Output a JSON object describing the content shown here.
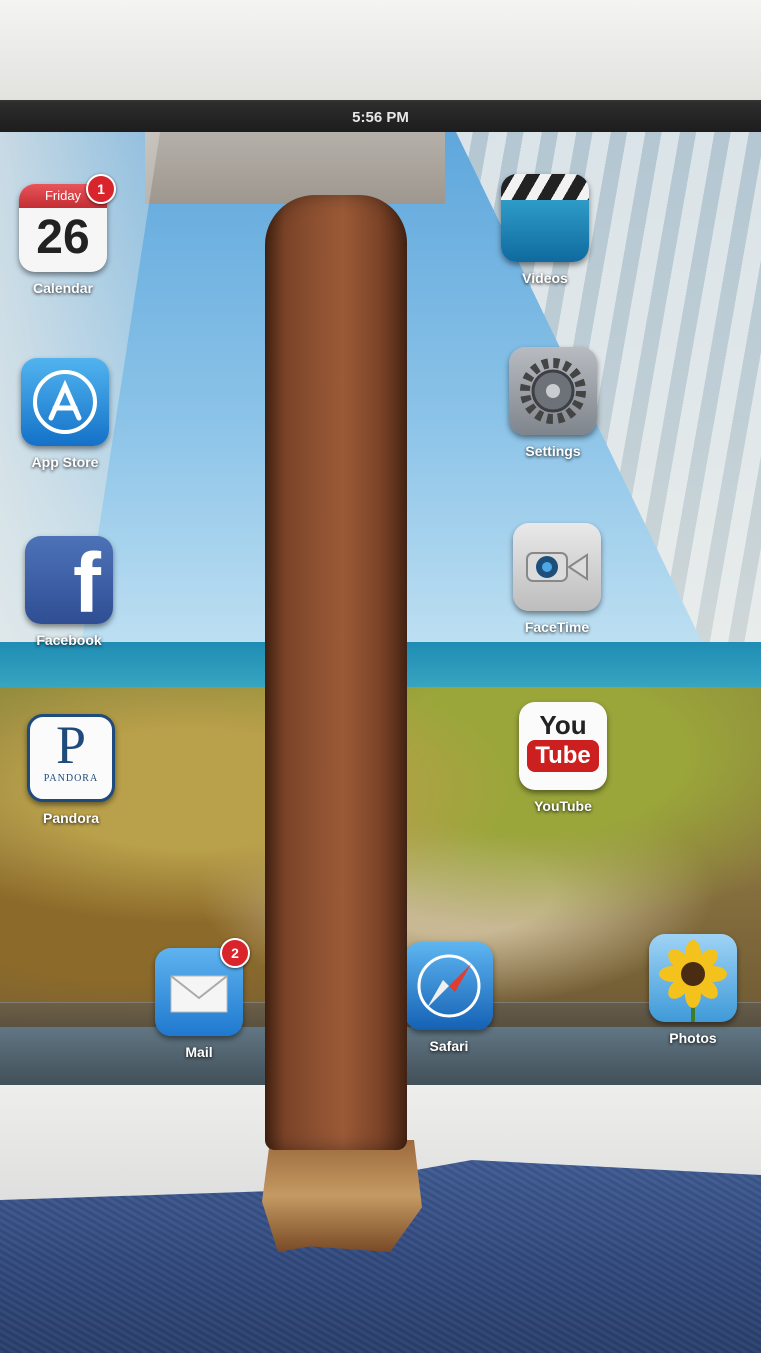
{
  "status_bar": {
    "time": "5:56 PM"
  },
  "home_screen": {
    "left_column": [
      {
        "label": "Calendar",
        "weekday": "Friday",
        "day": "26",
        "badge": "1",
        "icon": "calendar-icon"
      },
      {
        "label": "App Store",
        "icon": "app-store-icon"
      },
      {
        "label": "Facebook",
        "icon": "facebook-icon"
      },
      {
        "label": "Pandora",
        "icon": "pandora-icon",
        "wordmark": "PANDORA"
      }
    ],
    "right_column": [
      {
        "label": "Videos",
        "icon": "clapperboard-icon"
      },
      {
        "label": "Settings",
        "icon": "gear-icon"
      },
      {
        "label": "FaceTime",
        "icon": "video-camera-icon"
      },
      {
        "label": "YouTube",
        "icon": "youtube-icon",
        "text_top": "You",
        "text_bottom": "Tube"
      }
    ],
    "dock": [
      {
        "label": "Mail",
        "icon": "envelope-icon",
        "badge": "2"
      },
      {
        "label": "Safari",
        "icon": "compass-icon"
      },
      {
        "label": "Photos",
        "icon": "sunflower-icon"
      }
    ]
  },
  "colors": {
    "badge": "#d9242b",
    "cigar": "#8c5031",
    "cloth": "#2f477a"
  }
}
